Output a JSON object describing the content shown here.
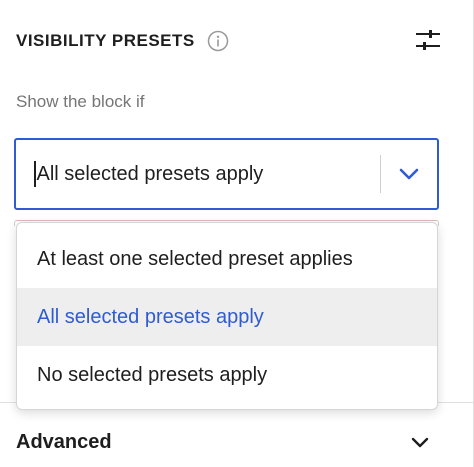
{
  "header": {
    "title": "VISIBILITY PRESETS",
    "info_icon": "info-icon",
    "settings_icon": "sliders-icon"
  },
  "show_label": "Show the block if",
  "select": {
    "value": "All selected presets apply",
    "chevron_icon": "chevron-down-icon"
  },
  "menu": {
    "options": [
      {
        "label": "At least one selected preset applies",
        "selected": false
      },
      {
        "label": "All selected presets apply",
        "selected": true
      },
      {
        "label": "No selected presets apply",
        "selected": false
      }
    ]
  },
  "advanced": {
    "label": "Advanced",
    "chevron_icon": "chevron-down-icon"
  },
  "colors": {
    "accent": "#2f5bd3",
    "text": "#1e1e1e",
    "muted": "#757575",
    "selected_bg": "#eeeeee"
  }
}
